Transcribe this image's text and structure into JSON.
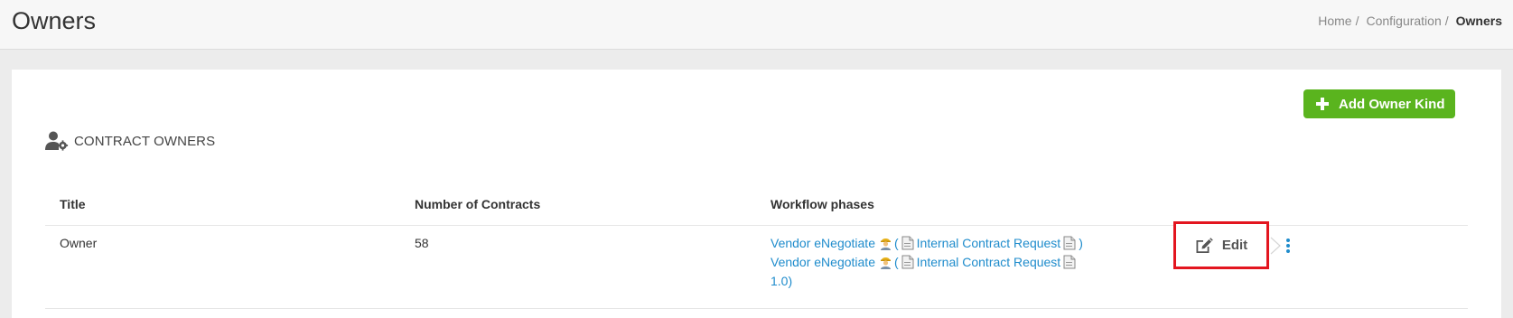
{
  "header": {
    "title": "Owners",
    "breadcrumb": [
      {
        "label": "Home",
        "sep": "/"
      },
      {
        "label": "Configuration",
        "sep": "/"
      },
      {
        "label": "Owners"
      }
    ]
  },
  "toolbar": {
    "add_label": "Add Owner Kind"
  },
  "section": {
    "label": "CONTRACT OWNERS",
    "icon": "user-cog-icon"
  },
  "table": {
    "columns": [
      "Title",
      "Number of Contracts",
      "Workflow phases"
    ],
    "rows": [
      {
        "title": "Owner",
        "contracts": "58",
        "phases": [
          {
            "name": "Vendor eNegotiate",
            "open": "(",
            "sub": "Internal Contract Request",
            "close": ")"
          },
          {
            "name": "Vendor eNegotiate",
            "open": "(",
            "sub": "Internal Contract Request",
            "close": "1.0)"
          }
        ],
        "action_label": "Edit"
      }
    ]
  },
  "colors": {
    "accent_green": "#5ab41e",
    "link_blue": "#1f8ccc",
    "highlight_red": "#e3151f"
  }
}
